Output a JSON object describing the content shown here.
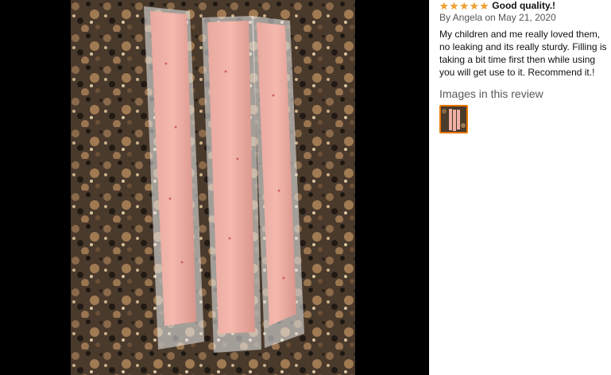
{
  "viewer": {
    "photo_icon": "review-photo-popsicle-bags"
  },
  "review": {
    "rating": 5,
    "title": "Good quality.!",
    "byline": "By Angela on May 21, 2020",
    "text": "My children and me really loved them, no leaking and its really sturdy. Filling is taking a bit time first then while using you will get use to it. Recommend it.!",
    "images_heading": "Images in this review"
  },
  "colors": {
    "star": "#f0a030",
    "thumb_border": "#e77600",
    "viewer_bg": "#000000"
  }
}
